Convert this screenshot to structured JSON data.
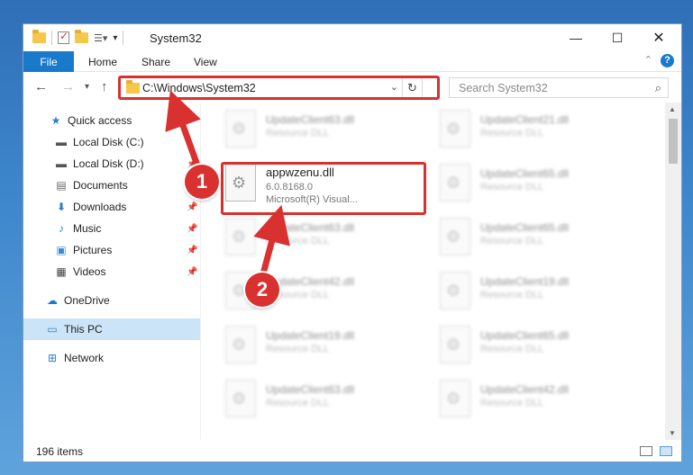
{
  "window": {
    "title": "System32"
  },
  "ribbon": {
    "file": "File",
    "home": "Home",
    "share": "Share",
    "view": "View"
  },
  "nav": {
    "address": "C:\\Windows\\System32",
    "search_placeholder": "Search System32"
  },
  "sidebar": {
    "items": [
      {
        "label": "Quick access",
        "icon": "star-icon",
        "pinned": false
      },
      {
        "label": "Local Disk (C:)",
        "icon": "drive-icon",
        "pinned": false
      },
      {
        "label": "Local Disk (D:)",
        "icon": "drive-icon",
        "pinned": true
      },
      {
        "label": "Documents",
        "icon": "document-icon",
        "pinned": true
      },
      {
        "label": "Downloads",
        "icon": "download-icon",
        "pinned": true
      },
      {
        "label": "Music",
        "icon": "music-icon",
        "pinned": true
      },
      {
        "label": "Pictures",
        "icon": "picture-icon",
        "pinned": true
      },
      {
        "label": "Videos",
        "icon": "video-icon",
        "pinned": true
      },
      {
        "label": "OneDrive",
        "icon": "cloud-icon",
        "pinned": false
      },
      {
        "label": "This PC",
        "icon": "computer-icon",
        "pinned": false,
        "selected": true
      },
      {
        "label": "Network",
        "icon": "network-icon",
        "pinned": false
      }
    ]
  },
  "files": {
    "highlighted": {
      "name": "appwzenu.dll",
      "version": "6.0.8168.0",
      "company": "Microsoft(R) Visual..."
    },
    "blurred": [
      {
        "name": "UpdateClient63.dll",
        "type": "Resource DLL"
      },
      {
        "name": "UpdateClient21.dll",
        "type": "Resource DLL"
      },
      {
        "name": "UpdateClient65.dll",
        "type": "Resource DLL"
      },
      {
        "name": "UpdateClient63.dll",
        "type": "Resource DLL"
      },
      {
        "name": "UpdateClient65.dll",
        "type": "Resource DLL"
      },
      {
        "name": "UpdateClient42.dll",
        "type": "Resource DLL"
      },
      {
        "name": "UpdateClient19.dll",
        "type": "Resource DLL"
      },
      {
        "name": "UpdateClient19.dll",
        "type": "Resource DLL"
      },
      {
        "name": "UpdateClient65.dll",
        "type": "Resource DLL"
      },
      {
        "name": "UpdateClient63.dll",
        "type": "Resource DLL"
      },
      {
        "name": "UpdateClient42.dll",
        "type": "Resource DLL"
      }
    ]
  },
  "status": {
    "count": "196 items"
  },
  "annotations": {
    "step1": "1",
    "step2": "2"
  },
  "colors": {
    "accent": "#1979ca",
    "annotation": "#d9312f",
    "selected": "#cce4f7"
  }
}
